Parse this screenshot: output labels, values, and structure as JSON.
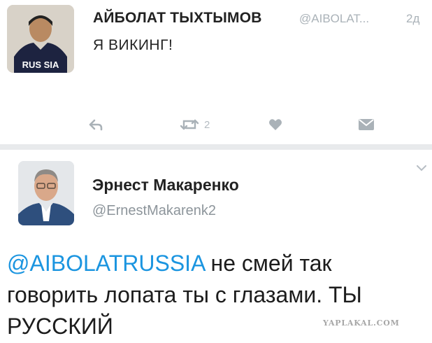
{
  "tweet1": {
    "author_name": "АЙБОЛАТ ТЫХТЫМОВ",
    "handle": "@AIBOLAT...",
    "time": "2д",
    "text": "Я ВИКИНГ!",
    "avatar_shirt_text": "RUS SIA",
    "retweet_count": "2",
    "icons": [
      "reply-icon",
      "retweet-icon",
      "heart-icon",
      "direct-message-icon"
    ]
  },
  "tweet2": {
    "author_name": "Эрнест Макаренко",
    "handle": "@ErnestMakarenk2",
    "mention": "@AIBOLATRUSSIA",
    "text_line1_rest": " не смей так",
    "text_line2": "говорить лопата ты с глазами.  ТЫ",
    "text_line3": "РУССКИЙ",
    "icons": [
      "chevron-down-icon"
    ]
  },
  "watermark": "YAPLAKAL.COM",
  "colors": {
    "link": "#1b95e0",
    "muted": "#aab2b8",
    "divider": "#e8eaec"
  }
}
